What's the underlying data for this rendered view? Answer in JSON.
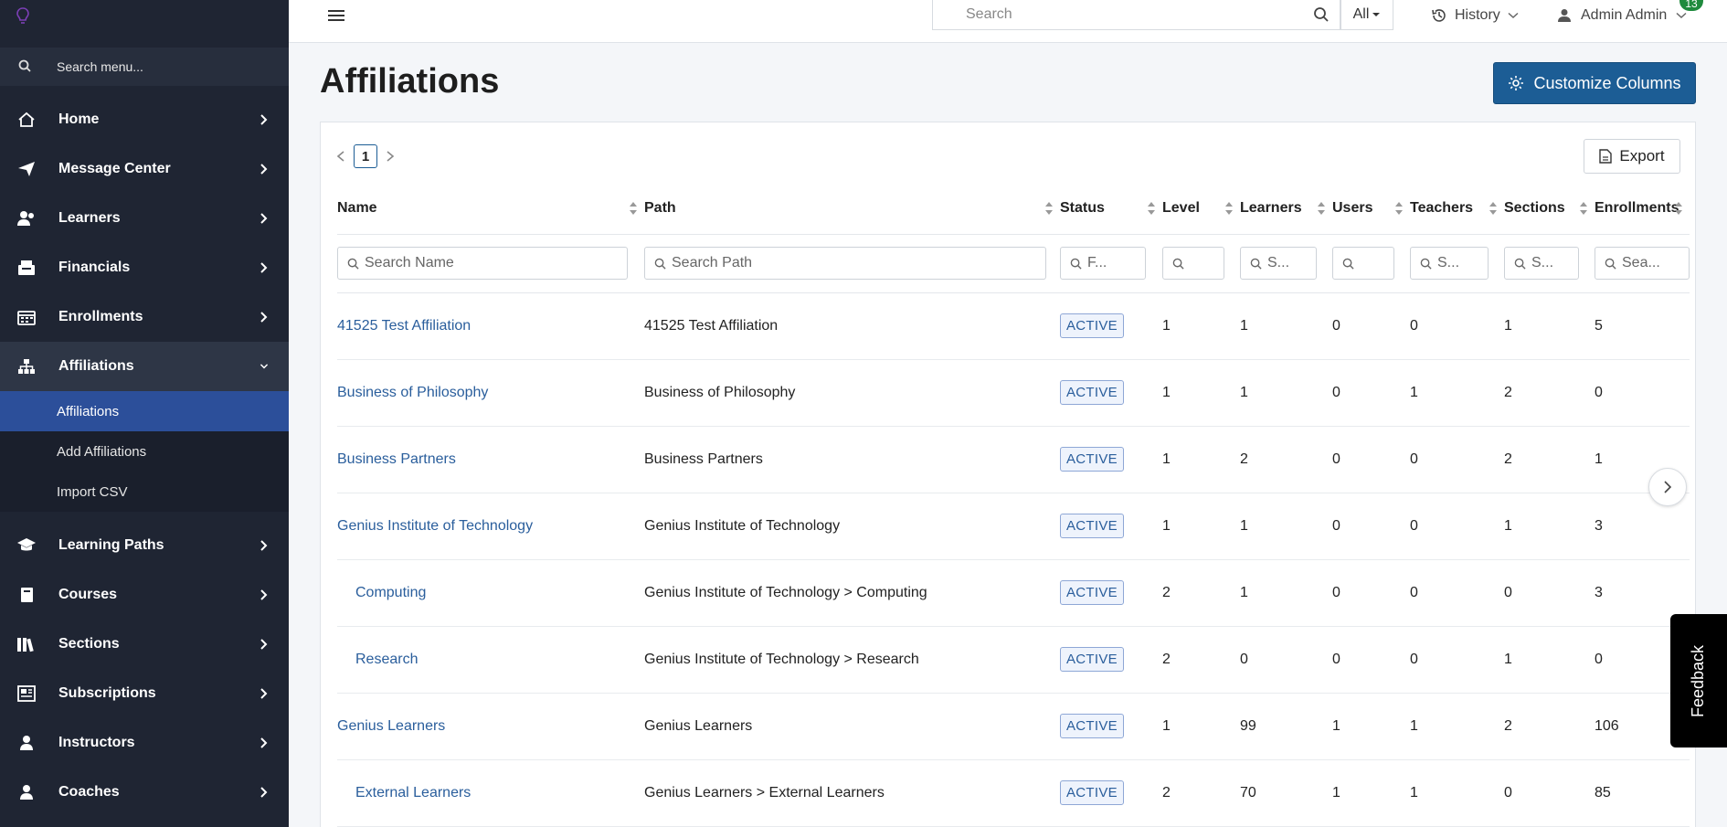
{
  "sidebar": {
    "search_label": "Search menu...",
    "items": [
      {
        "label": "Home",
        "icon": "home-icon"
      },
      {
        "label": "Message Center",
        "icon": "paper-plane-icon"
      },
      {
        "label": "Learners",
        "icon": "users-icon"
      },
      {
        "label": "Financials",
        "icon": "register-icon"
      },
      {
        "label": "Enrollments",
        "icon": "calendar-icon"
      },
      {
        "label": "Affiliations",
        "icon": "sitemap-icon"
      }
    ],
    "sub_items": [
      {
        "label": "Affiliations"
      },
      {
        "label": "Add Affiliations"
      },
      {
        "label": "Import CSV"
      }
    ],
    "items_after": [
      {
        "label": "Learning Paths",
        "icon": "graduation-cap-icon"
      },
      {
        "label": "Courses",
        "icon": "book-icon"
      },
      {
        "label": "Sections",
        "icon": "books-icon"
      },
      {
        "label": "Subscriptions",
        "icon": "newspaper-icon"
      },
      {
        "label": "Instructors",
        "icon": "instructor-icon"
      },
      {
        "label": "Coaches",
        "icon": "coach-icon"
      }
    ]
  },
  "topbar": {
    "search_placeholder": "Search",
    "scope": "All",
    "history": "History",
    "user": "Admin Admin",
    "badge": "13"
  },
  "page": {
    "title": "Affiliations",
    "customize": "Customize Columns",
    "export": "Export",
    "current_page": "1",
    "feedback": "Feedback"
  },
  "table": {
    "columns": [
      "Name",
      "Path",
      "Status",
      "Level",
      "Learners",
      "Users",
      "Teachers",
      "Sections",
      "Enrollments"
    ],
    "filters": [
      "Search Name",
      "Search Path",
      "F...",
      "",
      "S...",
      "",
      "S...",
      "S...",
      "Sea..."
    ],
    "rows": [
      {
        "name": "41525 Test Affiliation",
        "indent": false,
        "path": "41525 Test Affiliation",
        "status": "ACTIVE",
        "level": "1",
        "learners": "1",
        "users": "0",
        "teachers": "0",
        "sections": "1",
        "enrollments": "5"
      },
      {
        "name": "Business of Philosophy",
        "indent": false,
        "path": "Business of Philosophy",
        "status": "ACTIVE",
        "level": "1",
        "learners": "1",
        "users": "0",
        "teachers": "1",
        "sections": "2",
        "enrollments": "0"
      },
      {
        "name": "Business Partners",
        "indent": false,
        "path": "Business Partners",
        "status": "ACTIVE",
        "level": "1",
        "learners": "2",
        "users": "0",
        "teachers": "0",
        "sections": "2",
        "enrollments": "1"
      },
      {
        "name": "Genius Institute of Technology",
        "indent": false,
        "path": "Genius Institute of Technology",
        "status": "ACTIVE",
        "level": "1",
        "learners": "1",
        "users": "0",
        "teachers": "0",
        "sections": "1",
        "enrollments": "3"
      },
      {
        "name": "Computing",
        "indent": true,
        "path": "Genius Institute of Technology > Computing",
        "status": "ACTIVE",
        "level": "2",
        "learners": "1",
        "users": "0",
        "teachers": "0",
        "sections": "0",
        "enrollments": "3"
      },
      {
        "name": "Research",
        "indent": true,
        "path": "Genius Institute of Technology > Research",
        "status": "ACTIVE",
        "level": "2",
        "learners": "0",
        "users": "0",
        "teachers": "0",
        "sections": "1",
        "enrollments": "0"
      },
      {
        "name": "Genius Learners",
        "indent": false,
        "path": "Genius Learners",
        "status": "ACTIVE",
        "level": "1",
        "learners": "99",
        "users": "1",
        "teachers": "1",
        "sections": "2",
        "enrollments": "106"
      },
      {
        "name": "External Learners",
        "indent": true,
        "path": "Genius Learners > External Learners",
        "status": "ACTIVE",
        "level": "2",
        "learners": "70",
        "users": "1",
        "teachers": "1",
        "sections": "0",
        "enrollments": "85"
      }
    ]
  }
}
